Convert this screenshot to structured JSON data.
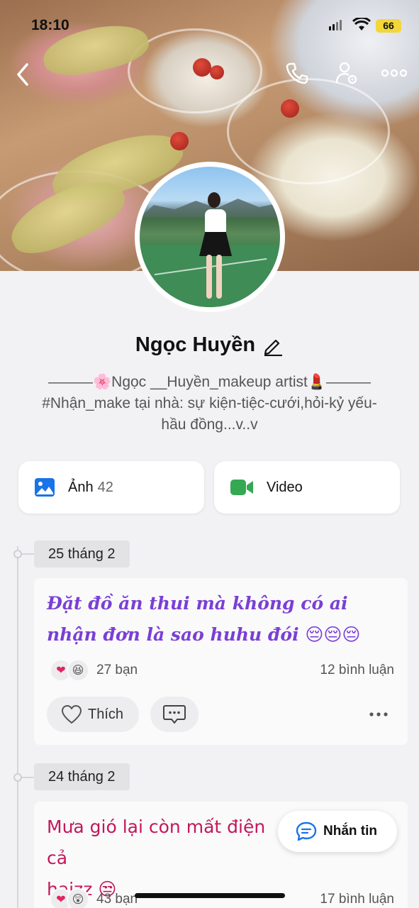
{
  "status_bar": {
    "time": "18:10",
    "battery": "66"
  },
  "header_actions": {
    "back_icon": "chevron-left-icon",
    "call_icon": "phone-icon",
    "settings_icon": "user-settings-icon",
    "more_icon": "more-horizontal-icon"
  },
  "profile": {
    "name": "Ngọc Huyền",
    "bio_line1": "———🌸Ngọc __Huyền_makeup artist💄———",
    "bio_line2": "#Nhận_make tại nhà: sự kiện-tiệc-cưới,hỏi-kỷ yếu-",
    "bio_line3": "hầu đồng...v..v"
  },
  "media": {
    "photos_label": "Ảnh",
    "photos_count": "42",
    "photos_icon": "image-icon",
    "photos_color": "#1a73e8",
    "video_label": "Video",
    "video_icon": "video-camera-icon",
    "video_color": "#34a853"
  },
  "posts": [
    {
      "date": "25 tháng 2",
      "text": "Đặt đồ ăn thui mà không có ai nhận đơn là sao huhu đói",
      "emojis": "😔😔😔",
      "reactions": [
        "❤",
        "😆"
      ],
      "reaction_count": "27 bạn",
      "comment_count": "12 bình luận",
      "like_label": "Thích"
    },
    {
      "date": "24 tháng 2",
      "text": "Mưa gió lại còn mất điện cả",
      "text_line2": "haizz",
      "emojis": "😒",
      "reactions": [
        "❤",
        "😲"
      ],
      "reaction_count": "43 bạn",
      "comment_count": "17 bình luận"
    }
  ],
  "message_button": {
    "label": "Nhắn tin",
    "icon": "chat-bubble-icon"
  }
}
